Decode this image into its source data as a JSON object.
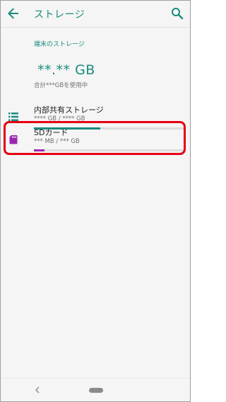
{
  "header": {
    "title": "ストレージ"
  },
  "device_storage": {
    "section_label": "端末のストレージ",
    "total_used": "**.** GB",
    "total_caption": "合計***GBを使用中"
  },
  "items": [
    {
      "label": "内部共有ストレージ",
      "detail": "**** GB / **** GB",
      "usage_fraction": 0.44,
      "bar_color": "#1a8b7e",
      "icon": "list-icon"
    },
    {
      "label": "SDカード",
      "detail": "*** MB / *** GB",
      "usage_fraction": 0.07,
      "bar_color": "#9c27b0",
      "icon": "sd-card-icon"
    }
  ],
  "colors": {
    "accent": "#1a8b7e",
    "highlight": "#e60012"
  }
}
